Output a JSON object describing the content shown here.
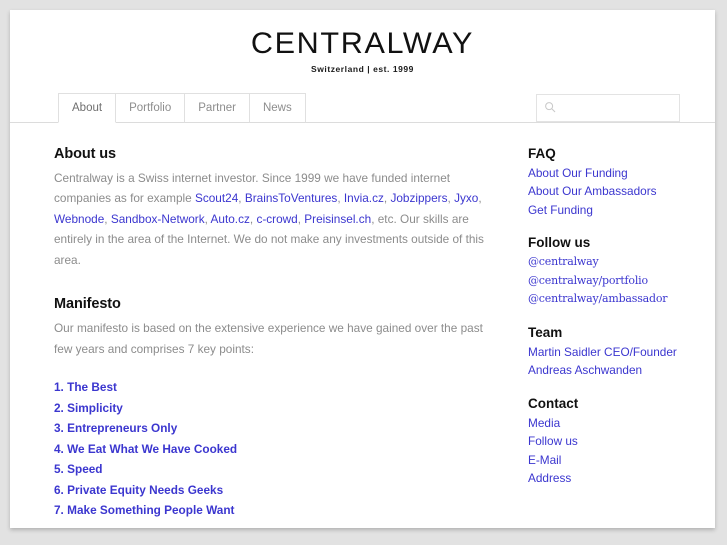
{
  "header": {
    "brand": "CENTRALWAY",
    "tagline": "Switzerland | est. 1999"
  },
  "nav": {
    "tabs": [
      {
        "label": "About",
        "active": true
      },
      {
        "label": "Portfolio",
        "active": false
      },
      {
        "label": "Partner",
        "active": false
      },
      {
        "label": "News",
        "active": false
      }
    ],
    "search": {
      "icon": "search-icon",
      "value": "",
      "placeholder": ""
    }
  },
  "main": {
    "about": {
      "title": "About us",
      "paragraph_parts": [
        {
          "type": "text",
          "text": "Centralway is a Swiss internet investor. Since 1999 we have funded internet companies as for example "
        },
        {
          "type": "link",
          "text": "Scout24"
        },
        {
          "type": "text",
          "text": ", "
        },
        {
          "type": "link",
          "text": "BrainsToVentures"
        },
        {
          "type": "text",
          "text": ", "
        },
        {
          "type": "link",
          "text": "Invia.cz"
        },
        {
          "type": "text",
          "text": ", "
        },
        {
          "type": "link",
          "text": "Jobzippers"
        },
        {
          "type": "text",
          "text": ", "
        },
        {
          "type": "link",
          "text": "Jyxo"
        },
        {
          "type": "text",
          "text": ", "
        },
        {
          "type": "link",
          "text": "Webnode"
        },
        {
          "type": "text",
          "text": ", "
        },
        {
          "type": "link",
          "text": "Sandbox-Network"
        },
        {
          "type": "text",
          "text": ", "
        },
        {
          "type": "link",
          "text": "Auto.cz"
        },
        {
          "type": "text",
          "text": ", "
        },
        {
          "type": "link",
          "text": "c-crowd"
        },
        {
          "type": "text",
          "text": ", "
        },
        {
          "type": "link",
          "text": "Preisinsel.ch"
        },
        {
          "type": "text",
          "text": ", etc. Our skills are entirely in the area of the Internet. We do not make any investments outside of this area."
        }
      ]
    },
    "manifesto": {
      "title": "Manifesto",
      "paragraph": "Our manifesto is based on the extensive experience we have gained over the past few years and comprises 7 key points:",
      "points": [
        "1. The Best",
        "2. Simplicity",
        "3. Entrepreneurs Only",
        "4. We Eat What We Have Cooked",
        "5. Speed",
        "6. Private Equity Needs Geeks",
        "7. Make Something People Want"
      ]
    }
  },
  "sidebar": {
    "groups": [
      {
        "title": "FAQ",
        "serif": false,
        "links": [
          "About Our Funding",
          "About Our Ambassadors",
          "Get Funding"
        ]
      },
      {
        "title": "Follow us",
        "serif": true,
        "links": [
          "@centralway",
          "@centralway/portfolio",
          "@centralway/ambassador"
        ]
      },
      {
        "title": "Team",
        "serif": false,
        "links": [
          "Martin Saidler CEO/Founder",
          "Andreas Aschwanden"
        ]
      },
      {
        "title": "Contact",
        "serif": false,
        "links": [
          "Media",
          "Follow us",
          "E-Mail",
          "Address"
        ]
      }
    ]
  },
  "colors": {
    "link": "#3b36cf",
    "body_text": "#8c8c8c",
    "heading": "#111111",
    "page_bg": "#e2e2e2",
    "card_bg": "#ffffff",
    "border": "#e0e0e0"
  }
}
